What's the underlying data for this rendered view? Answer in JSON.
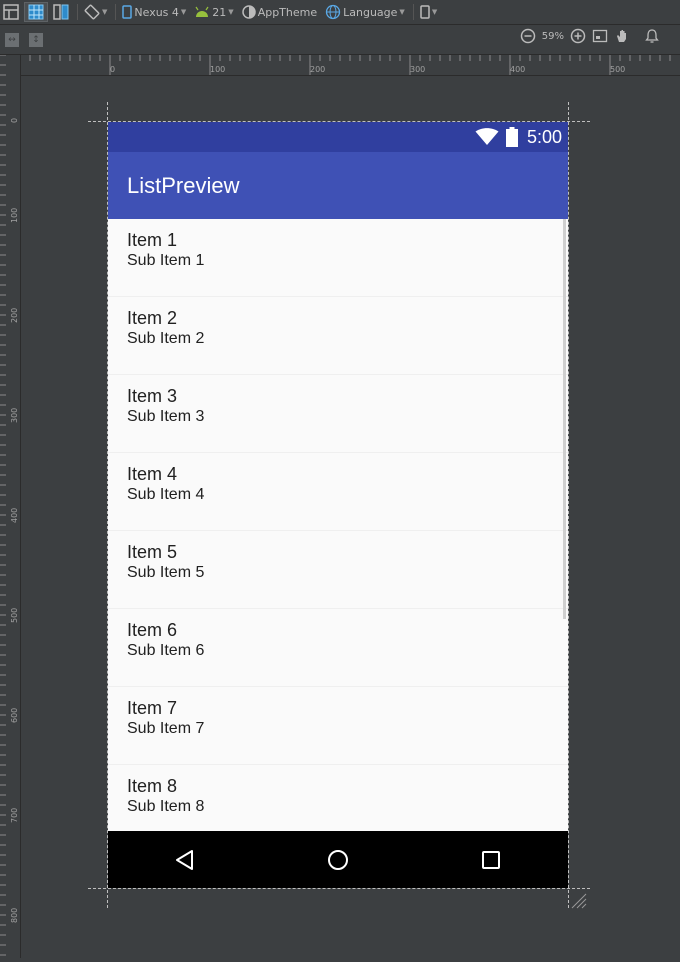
{
  "toolbar": {
    "device_label": "Nexus 4",
    "api_label": "21",
    "theme_label": "AppTheme",
    "language_label": "Language"
  },
  "zoom": {
    "level": "59%"
  },
  "rulers": {
    "horizontal_ticks": [
      "0",
      "100",
      "200",
      "300",
      "400",
      "500"
    ],
    "vertical_ticks": [
      "0",
      "100",
      "200",
      "300",
      "400",
      "500",
      "600",
      "700",
      "800"
    ]
  },
  "device": {
    "status_bar": {
      "time": "5:00",
      "color": "#303f9f"
    },
    "app_bar": {
      "title": "ListPreview",
      "color": "#3f51b5"
    },
    "list": {
      "items": [
        {
          "title": "Item 1",
          "subtitle": "Sub Item 1"
        },
        {
          "title": "Item 2",
          "subtitle": "Sub Item 2"
        },
        {
          "title": "Item 3",
          "subtitle": "Sub Item 3"
        },
        {
          "title": "Item 4",
          "subtitle": "Sub Item 4"
        },
        {
          "title": "Item 5",
          "subtitle": "Sub Item 5"
        },
        {
          "title": "Item 6",
          "subtitle": "Sub Item 6"
        },
        {
          "title": "Item 7",
          "subtitle": "Sub Item 7"
        },
        {
          "title": "Item 8",
          "subtitle": "Sub Item 8"
        }
      ]
    },
    "nav_bar": {
      "buttons": [
        "back-icon",
        "home-icon",
        "recents-icon"
      ]
    }
  }
}
